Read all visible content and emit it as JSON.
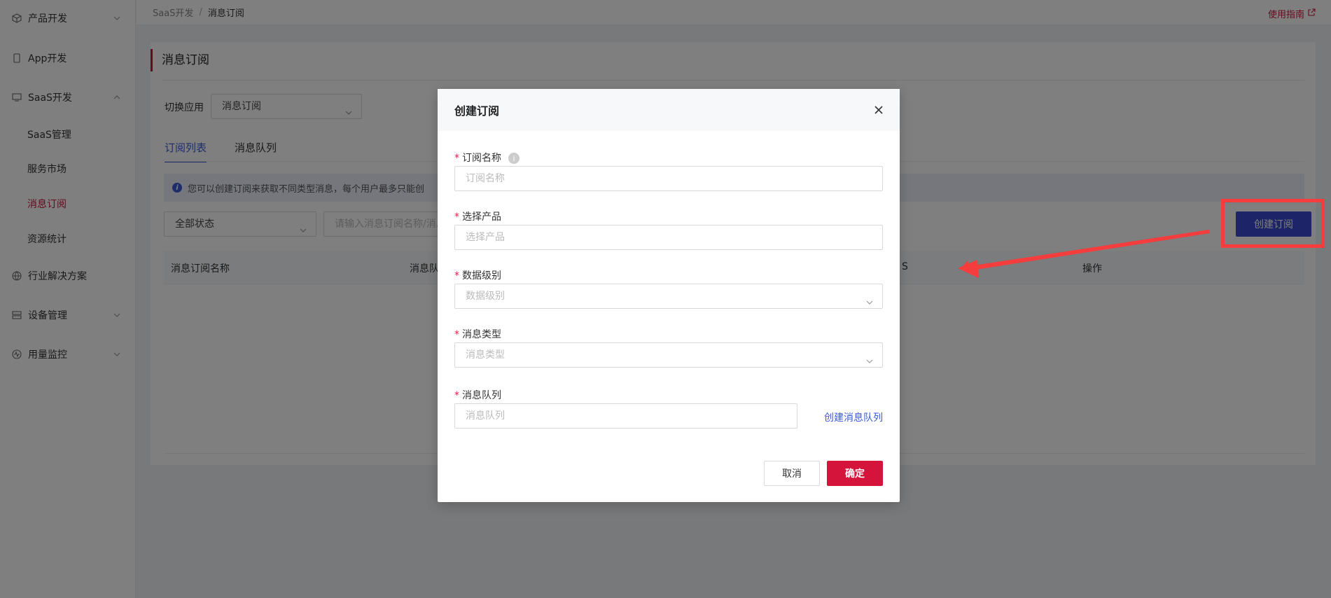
{
  "sidebar": {
    "items": [
      {
        "label": "产品开发",
        "icon": "cube-icon"
      },
      {
        "label": "App开发",
        "icon": "phone-icon"
      },
      {
        "label": "SaaS开发",
        "icon": "monitor-icon"
      },
      {
        "label": "行业解决方案",
        "icon": "globe-icon"
      },
      {
        "label": "设备管理",
        "icon": "server-icon"
      },
      {
        "label": "用量监控",
        "icon": "pulse-icon"
      }
    ],
    "sub_items": [
      {
        "label": "SaaS管理"
      },
      {
        "label": "服务市场"
      },
      {
        "label": "消息订阅"
      },
      {
        "label": "资源统计"
      }
    ]
  },
  "breadcrumb": {
    "parent": "SaaS开发",
    "separator": "/",
    "current": "消息订阅"
  },
  "guide_link": "使用指南",
  "page": {
    "title": "消息订阅",
    "switch_label": "切换应用",
    "switch_value": "消息订阅",
    "tabs": [
      {
        "label": "订阅列表"
      },
      {
        "label": "消息队列"
      }
    ],
    "info_text": "您可以创建订阅来获取不同类型消息，每个用户最多只能创",
    "status_filter": "全部状态",
    "search_placeholder": "请输入消息订阅名称/消息",
    "create_button": "创建订阅",
    "table_headers": [
      "消息订阅名称",
      "消息队",
      "S",
      "操作"
    ]
  },
  "modal": {
    "title": "创建订阅",
    "fields": [
      {
        "label": "订阅名称",
        "placeholder": "订阅名称"
      },
      {
        "label": "选择产品",
        "placeholder": "选择产品"
      },
      {
        "label": "数据级别",
        "placeholder": "数据级别"
      },
      {
        "label": "消息类型",
        "placeholder": "消息类型"
      },
      {
        "label": "消息队列",
        "placeholder": "消息队列"
      }
    ],
    "required_mark": "*",
    "create_queue_link": "创建消息队列",
    "cancel": "取消",
    "confirm": "确定"
  },
  "colors": {
    "brand_red": "#c9153b",
    "primary_blue": "#3a4bd0",
    "annotation_red": "#f53d3d"
  }
}
